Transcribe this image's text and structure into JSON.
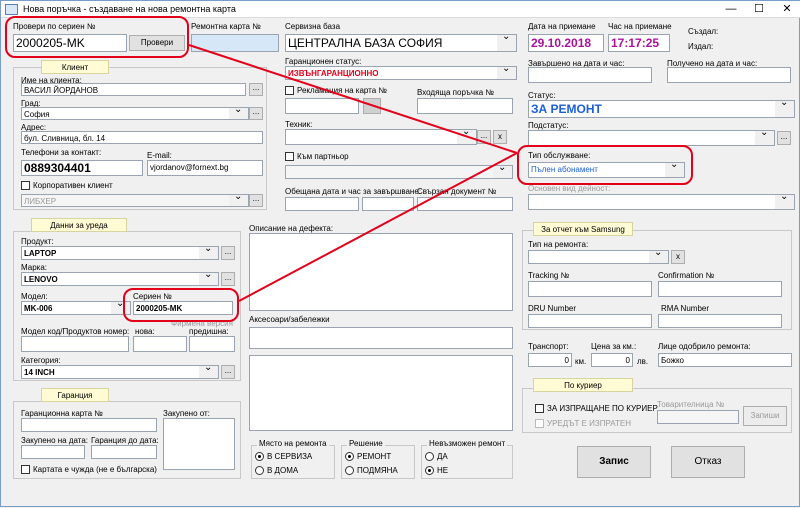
{
  "window": {
    "title": "Нова поръчка - създаване на нова ремонтна карта",
    "min": "—",
    "max": "☐",
    "close": "✕"
  },
  "serial_check": {
    "label": "Провери по сериен №",
    "value": "2000205-MK",
    "button": "Провери"
  },
  "repair_card": {
    "label": "Ремонтна карта №"
  },
  "service_base": {
    "label": "Сервизна база",
    "value": "ЦЕНТРАЛНА БАЗА СОФИЯ"
  },
  "intake": {
    "date_label": "Дата на приемане",
    "date": "29.10.2018",
    "time_label": "Час на приемане",
    "time": "17:17:25",
    "created_label": "Създал:",
    "issued_label": "Издал:"
  },
  "client": {
    "header": "Клиент",
    "name_label": "Име на клиента:",
    "name": "ВАСИЛ ЙОРДАНОВ",
    "city_label": "Град:",
    "city": "София",
    "address_label": "Адрес:",
    "address": "бул. Сливница, бл. 14",
    "phones_label": "Телефони за контакт:",
    "phone": "0889304401",
    "email_label": "E-mail:",
    "email": "vjordanov@fornext.bg",
    "corporate_label": "Корпоративен клиент",
    "company": "ЛИБХЕР",
    "dots": "..."
  },
  "warranty_status": {
    "label": "Гаранционен статус:",
    "value": "ИЗВЪНГАРАНЦИОННО"
  },
  "complaint": {
    "label": "Рекламация на карта №"
  },
  "incoming_order": {
    "label": "Входяща поръчка №"
  },
  "technician": {
    "label": "Техник:",
    "x": "x"
  },
  "partner": {
    "label": "Към партньор"
  },
  "promised": {
    "label": "Обещана дата и час за завършване:",
    "ref_label": "Свързан документ №"
  },
  "completed": {
    "label": "Завършено на дата и час:"
  },
  "received": {
    "label": "Получено на дата и час:"
  },
  "status": {
    "label": "Статус:",
    "value": "ЗА РЕМОНТ"
  },
  "substatus": {
    "label": "Подстатус:"
  },
  "service_type": {
    "label": "Тип обслужване:",
    "value": "Пълен абонамент"
  },
  "main_activity": {
    "label": "Основен вид дейност:"
  },
  "device": {
    "header": "Данни за уреда",
    "product_label": "Продукт:",
    "product": "LAPTOP",
    "brand_label": "Марка:",
    "brand": "LENOVO",
    "model_label": "Модел:",
    "model": "MK-006",
    "serial_label": "Сериен №",
    "serial": "2000205-MK",
    "code_label": "Модел код/Продуктов номер:",
    "new_label": "нова:",
    "prev_label": "предишна:",
    "ver_label": "Фирмена версия",
    "category_label": "Категория:",
    "category": "14 INCH"
  },
  "defect": {
    "label": "Описание на дефекта:"
  },
  "accessories": {
    "label": "Аксесоари/забележки"
  },
  "samsung": {
    "header": "За отчет към Samsung",
    "type_label": "Тип на ремонта:",
    "tracking_label": "Tracking №",
    "confirmation_label": "Confirmation №",
    "dru_label": "DRU Number",
    "rma_label": "RMA Number"
  },
  "costs": {
    "transport_label": "Транспорт:",
    "transport": "0",
    "km_price_label": "Цена за км.:",
    "km_price": "0",
    "km_unit": "км.",
    "lv_unit": "лв.",
    "approver_label": "Лице одобрило ремонта:",
    "approver": "Божко"
  },
  "courier": {
    "header": "По куриер",
    "send_label": "ЗА ИЗПРАЩАНЕ ПО КУРИЕР",
    "sent_label": "УРЕДЪТ Е ИЗПРАТЕН",
    "waybill_label": "Товарителница №",
    "button": "Запиши"
  },
  "guarantee": {
    "header": "Гаранция",
    "card_label": "Гаранционна карта №",
    "bought_label": "Закупено от:",
    "date_label": "Закупено на дата:",
    "until_label": "Гаранция до дата:",
    "foreign_label": "Картата е чужда (не е българска)"
  },
  "place": {
    "label": "Място на ремонта",
    "opt1": "В СЕРВИЗА",
    "opt2": "В ДОМА"
  },
  "decision": {
    "label": "Решение",
    "opt1": "РЕМОНТ",
    "opt2": "ПОДМЯНА"
  },
  "impossible": {
    "label": "Невъзможен ремонт",
    "opt1": "ДА",
    "opt2": "НЕ"
  },
  "actions": {
    "save": "Запис",
    "cancel": "Отказ"
  },
  "colors": {
    "accent_red": "#e3001b",
    "status_blue": "#1c5fd6",
    "date_magenta": "#a8139a"
  }
}
